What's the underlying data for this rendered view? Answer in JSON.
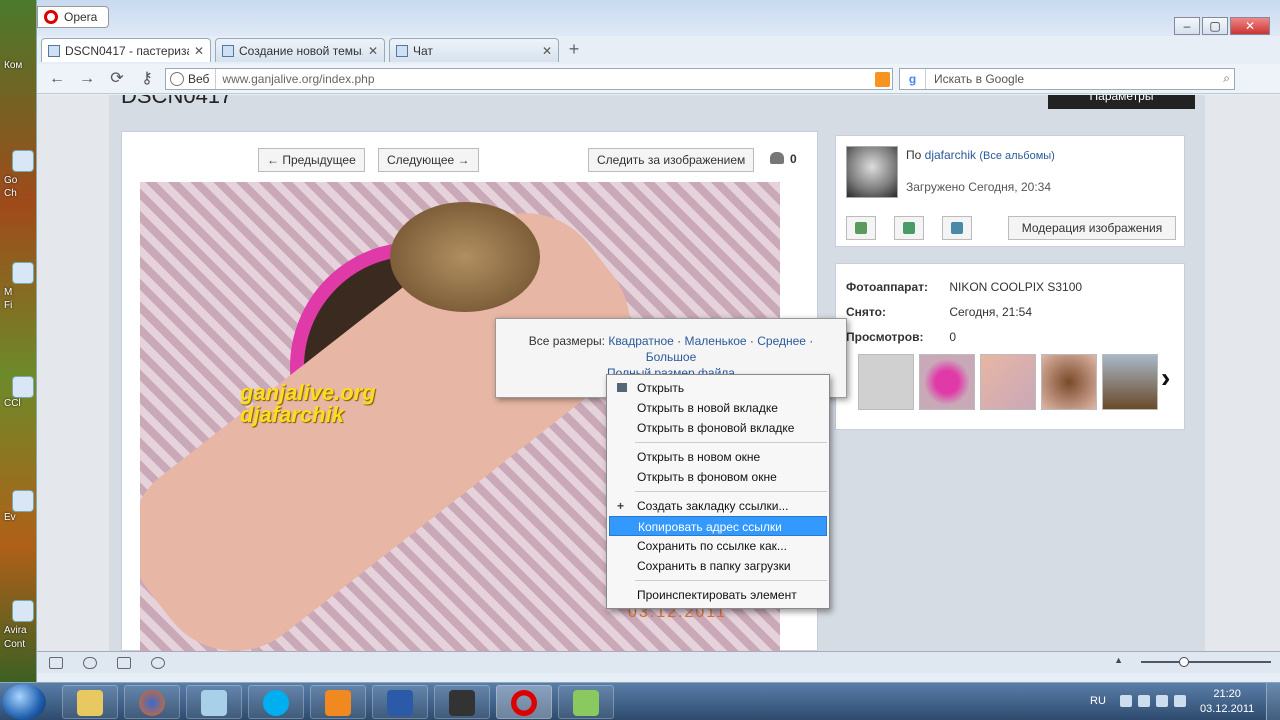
{
  "browser": {
    "menu_label": "Opera",
    "tabs": [
      {
        "label": "DSCN0417 - пастериза..."
      },
      {
        "label": "Создание новой темы..."
      },
      {
        "label": "Чат"
      }
    ],
    "address": {
      "scheme_label": "Веб",
      "url": "www.ganjalive.org/index.php"
    },
    "search": {
      "placeholder": "Искать в Google"
    }
  },
  "page": {
    "image_title": "DSCN0417",
    "params_button": "Параметры",
    "prev_button": "← Предыдущее",
    "next_button": "Следующее →",
    "follow_button": "Следить за изображением",
    "follow_count": "0",
    "watermark_line1": "ganjalive.org",
    "watermark_line2": "djafarchik",
    "photo_date": "03.12.2011",
    "sizes": {
      "prefix": "Все размеры:",
      "square": "Квадратное",
      "small": "Маленькое",
      "medium": "Среднее",
      "large": "Большое",
      "full_link": "Полный размер файла"
    },
    "author": {
      "by_prefix": "По",
      "name": "djafarchik",
      "all_albums": "(Все альбомы)",
      "uploaded": "Загружено Сегодня, 20:34",
      "moderate_button": "Модерация изображения"
    },
    "info": [
      {
        "key": "Фотоаппарат:",
        "value": "NIKON COOLPIX S3100"
      },
      {
        "key": "Снято:",
        "value": "Сегодня, 21:54"
      },
      {
        "key": "Просмотров:",
        "value": "0"
      }
    ]
  },
  "context_menu": {
    "items": [
      "Открыть",
      "Открыть в новой вкладке",
      "Открыть в фоновой вкладке",
      "Открыть в новом окне",
      "Открыть в фоновом окне",
      "Создать закладку ссылки...",
      "Копировать адрес ссылки",
      "Сохранить по ссылке как...",
      "Сохранить в папку загрузки",
      "Проинспектировать элемент"
    ],
    "highlighted": "Копировать адрес ссылки"
  },
  "desktop_labels": [
    "Ком",
    "Go",
    "Ch",
    "M",
    "Fi",
    "CCl",
    "Ev",
    "Avira",
    "Cont"
  ],
  "taskbar": {
    "lang": "RU",
    "time": "21:20",
    "date": "03.12.2011"
  },
  "colors": {
    "link": "#2a5a9a",
    "highlight": "#3399ff",
    "accent_pink": "#e03aa8",
    "watermark": "#ffdc1e"
  }
}
